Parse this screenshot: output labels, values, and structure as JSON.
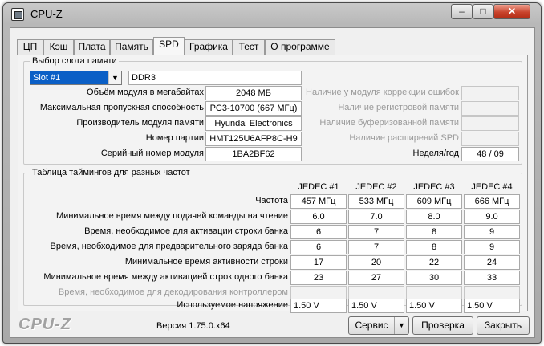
{
  "window": {
    "title": "CPU-Z",
    "controls": {
      "minimize": "–",
      "maximize": "□",
      "close": "✕"
    }
  },
  "tabs": [
    "ЦП",
    "Кэш",
    "Плата",
    "Память",
    "SPD",
    "Графика",
    "Тест",
    "О программе"
  ],
  "active_tab": "SPD",
  "slot": {
    "group_label": "Выбор слота памяти",
    "selected": "Slot #1",
    "memory_type": "DDR3",
    "left": [
      {
        "label": "Объём модуля в мегабайтах",
        "value": "2048 МБ"
      },
      {
        "label": "Максимальная пропускная способность",
        "value": "PC3-10700 (667 МГц)"
      },
      {
        "label": "Производитель модуля памяти",
        "value": "Hyundai Electronics"
      },
      {
        "label": "Номер партии",
        "value": "HMT125U6AFP8C-H9"
      },
      {
        "label": "Серийный номер модуля",
        "value": "1BA2BF62"
      }
    ],
    "right": [
      {
        "label": "Наличие у модуля коррекции ошибок",
        "value": ""
      },
      {
        "label": "Наличие регистровой памяти",
        "value": ""
      },
      {
        "label": "Наличие буферизованной памяти",
        "value": ""
      },
      {
        "label": "Наличие расширений SPD",
        "value": ""
      },
      {
        "label": "Неделя/год",
        "value": "48 / 09"
      }
    ]
  },
  "timings": {
    "group_label": "Таблица таймингов для разных частот",
    "columns": [
      "JEDEC #1",
      "JEDEC #2",
      "JEDEC #3",
      "JEDEC #4"
    ],
    "rows": [
      {
        "label": "Частота",
        "values": [
          "457 МГц",
          "533 МГц",
          "609 МГц",
          "666 МГц"
        ],
        "disabled": false
      },
      {
        "label": "Минимальное время между подачей команды на чтение",
        "values": [
          "6.0",
          "7.0",
          "8.0",
          "9.0"
        ],
        "disabled": false
      },
      {
        "label": "Время, необходимое для активации строки банка",
        "values": [
          "6",
          "7",
          "8",
          "9"
        ],
        "disabled": false
      },
      {
        "label": "Время, необходимое для предварительного заряда банка",
        "values": [
          "6",
          "7",
          "8",
          "9"
        ],
        "disabled": false
      },
      {
        "label": "Минимальное время активности строки",
        "values": [
          "17",
          "20",
          "22",
          "24"
        ],
        "disabled": false
      },
      {
        "label": "Минимальное время между активацией строк одного банка",
        "values": [
          "23",
          "27",
          "30",
          "33"
        ],
        "disabled": false
      },
      {
        "label": "Время, необходимое для декодирования контроллером",
        "values": [
          "",
          "",
          "",
          ""
        ],
        "disabled": true
      },
      {
        "label": "Используемое напряжение",
        "values": [
          "1.50 V",
          "1.50 V",
          "1.50 V",
          "1.50 V"
        ],
        "disabled": false
      }
    ]
  },
  "footer": {
    "brand": "CPU-Z",
    "version": "Версия 1.75.0.x64",
    "tools_button": "Сервис",
    "tools_arrow": "▼",
    "validate_button": "Проверка",
    "close_button": "Закрыть"
  }
}
